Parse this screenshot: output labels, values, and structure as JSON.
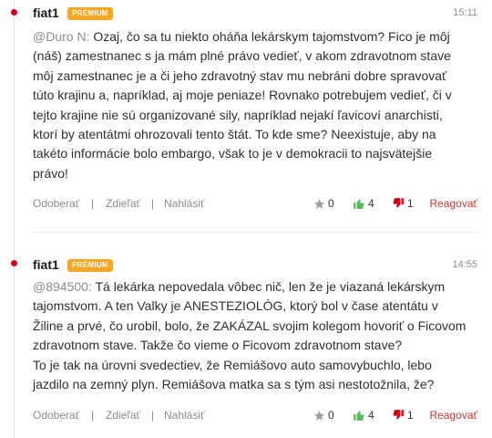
{
  "comments": [
    {
      "author": "fiat1",
      "badge": "PRÉMIUM",
      "time": "15:11",
      "mention": "@Duro N:",
      "lines": [
        " Ozaj, čo sa tu niekto oháňa lekárskym tajomstvom? Fico je môj",
        "(náš) zamestnanec s ja mám plné právo vedieť, v akom zdravotnom stave",
        "môj zamestnanec je a či jeho zdravotný stav mu nebráni dobre spravovať",
        "túto krajinu a, napríklad, aj moje peniaze! Rovnako potrebujem vedieť, či v",
        "tejto krajine nie sú organizované sily, napríklad nejakí ľavicoví anarchisti,",
        "ktorí by atentátmi ohrozovali tento štát. To kde sme? Neexistuje, aby na",
        "takéto informácie bolo embargo, však to je v demokracii to najsvätejšie",
        "právo!"
      ],
      "actions": {
        "unfollow": "Odoberať",
        "share": "Zdieľať",
        "report": "Nahlásiť",
        "separator": "|"
      },
      "votes": {
        "neutral": "0",
        "up": "4",
        "down": "1"
      },
      "reply": "Reagovať"
    },
    {
      "author": "fiat1",
      "badge": "PRÉMIUM",
      "time": "14:55",
      "mention": "@894500:",
      "lines": [
        " Tá lekárka nepovedala vôbec nič, len že je viazaná lekárskym",
        "tajomstvom. A ten Valky je ANESTEZIOLÓG, ktorý bol v čase atentátu v",
        "Žiline a prvé, čo urobil, bolo, že ZAKÁZAL svojim kolegom hovoriť o Ficovom",
        "zdravotnom stave. Takže čo vieme o Ficovom zdravotnom stave?",
        "To je tak na úrovni svedectiev, že Remiášovo auto samovybuchlo, lebo",
        "jazdilo na zemný plyn. Remiášova matka sa s tým asi nestotožnila, že?"
      ],
      "actions": {
        "unfollow": "Odoberať",
        "share": "Zdieľať",
        "report": "Nahlásiť",
        "separator": "|"
      },
      "votes": {
        "neutral": "0",
        "up": "4",
        "down": "1"
      },
      "reply": "Reagovať"
    }
  ],
  "colors": {
    "accent": "#d0021b",
    "badge": "#f5a623",
    "like": "#5cb85c",
    "dislike": "#d0021b",
    "star": "#a0a0a0"
  },
  "icons": {
    "neutral": "star-icon",
    "up": "thumbs-up-icon",
    "down": "thumbs-down-icon"
  }
}
